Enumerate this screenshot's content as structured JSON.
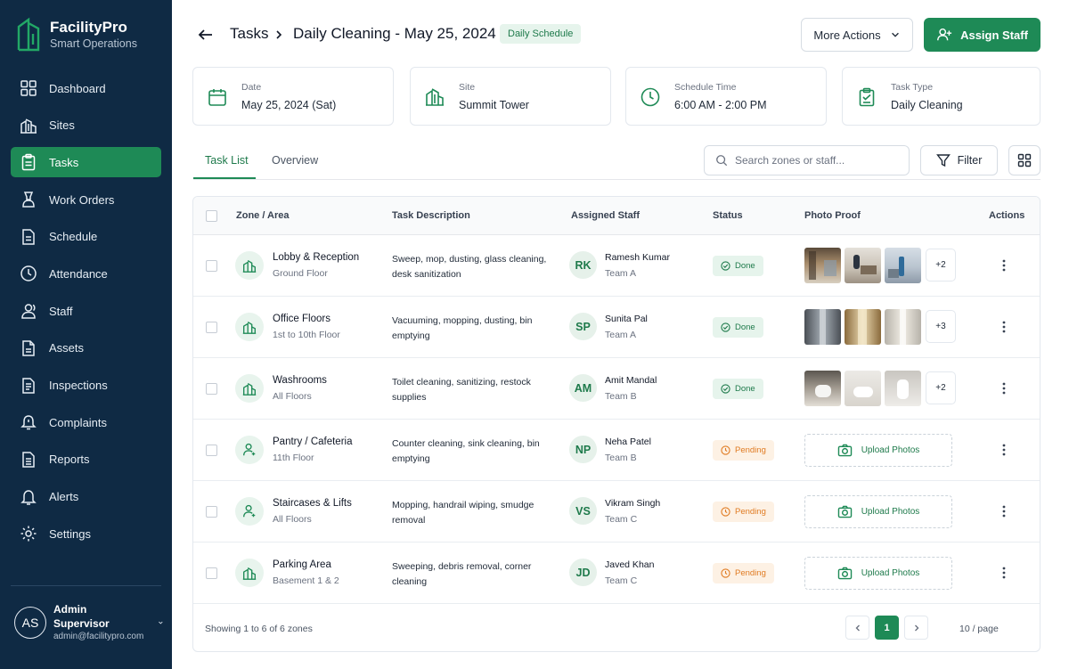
{
  "brand": {
    "name": "FacilityPro",
    "subtitle": "Smart Operations"
  },
  "sidebar": {
    "items": [
      {
        "label": "Dashboard",
        "icon": "dashboard-icon",
        "active": false
      },
      {
        "label": "Sites",
        "icon": "building-icon",
        "active": false
      },
      {
        "label": "Tasks",
        "icon": "clipboard-icon",
        "active": true
      },
      {
        "label": "Work Orders",
        "icon": "work-order-icon",
        "active": false
      },
      {
        "label": "Schedule",
        "icon": "document-icon",
        "active": false
      },
      {
        "label": "Attendance",
        "icon": "clock-icon",
        "active": false
      },
      {
        "label": "Staff",
        "icon": "users-icon",
        "active": false
      },
      {
        "label": "Assets",
        "icon": "file-icon",
        "active": false
      },
      {
        "label": "Inspections",
        "icon": "checklist-icon",
        "active": false
      },
      {
        "label": "Complaints",
        "icon": "alert-icon",
        "active": false
      },
      {
        "label": "Reports",
        "icon": "report-icon",
        "active": false
      },
      {
        "label": "Alerts",
        "icon": "bell-icon",
        "active": false
      },
      {
        "label": "Settings",
        "icon": "gear-icon",
        "active": false
      }
    ]
  },
  "user": {
    "initials": "AS",
    "name": "Admin Supervisor",
    "email": "admin@facilitypro.com"
  },
  "header": {
    "crumb_parent": "Tasks",
    "crumb_current": "Daily Cleaning - May 25, 2024",
    "badge": "Daily Schedule",
    "more_actions": "More Actions",
    "assign_staff": "Assign Staff"
  },
  "info_cards": [
    {
      "label": "Date",
      "value": "May 25, 2024 (Sat)",
      "icon": "calendar-icon"
    },
    {
      "label": "Site",
      "value": "Summit Tower",
      "icon": "building-icon"
    },
    {
      "label": "Schedule Time",
      "value": "6:00 AM - 2:00 PM",
      "icon": "clock-icon"
    },
    {
      "label": "Task Type",
      "value": "Daily Cleaning",
      "icon": "clipboard-icon"
    }
  ],
  "tabs": [
    {
      "label": "Task List",
      "active": true
    },
    {
      "label": "Overview",
      "active": false
    }
  ],
  "search": {
    "placeholder": "Search zones or staff..."
  },
  "filter_label": "Filter",
  "table": {
    "headers": [
      "Zone / Area",
      "Task Description",
      "Assigned Staff",
      "Status",
      "Photo Proof",
      "Actions"
    ],
    "rows": [
      {
        "zone": "Lobby & Reception",
        "floor": "Ground Floor",
        "desc": "Sweep, mop, dusting, glass cleaning, desk sanitization",
        "initials": "RK",
        "staff": "Ramesh Kumar",
        "team": "Team A",
        "status": "Done",
        "photos_more": "+2",
        "zone_icon": "building-icon",
        "status_color": "#1e7a4b"
      },
      {
        "zone": "Office Floors",
        "floor": "1st to 10th Floor",
        "desc": "Vacuuming, mopping, dusting, bin emptying",
        "initials": "SP",
        "staff": "Sunita Pal",
        "team": "Team A",
        "status": "Done",
        "photos_more": "+3",
        "zone_icon": "building-icon",
        "status_color": "#1e7a4b"
      },
      {
        "zone": "Washrooms",
        "floor": "All Floors",
        "desc": "Toilet cleaning, sanitizing, restock supplies",
        "initials": "AM",
        "staff": "Amit Mandal",
        "team": "Team B",
        "status": "Done",
        "photos_more": "+2",
        "zone_icon": "building-icon",
        "status_color": "#1e7a4b"
      },
      {
        "zone": "Pantry / Cafeteria",
        "floor": "11th Floor",
        "desc": "Counter cleaning, sink cleaning, bin emptying",
        "initials": "NP",
        "staff": "Neha Patel",
        "team": "Team B",
        "status": "Pending",
        "upload": "Upload Photos",
        "zone_icon": "user-pin-icon",
        "status_color": "#e07b22"
      },
      {
        "zone": "Staircases & Lifts",
        "floor": "All Floors",
        "desc": "Mopping, handrail wiping, smudge removal",
        "initials": "VS",
        "staff": "Vikram Singh",
        "team": "Team C",
        "status": "Pending",
        "upload": "Upload Photos",
        "zone_icon": "user-pin-icon",
        "status_color": "#e07b22"
      },
      {
        "zone": "Parking Area",
        "floor": "Basement 1 & 2",
        "desc": "Sweeping, debris removal, corner cleaning",
        "initials": "JD",
        "staff": "Javed Khan",
        "team": "Team C",
        "status": "Pending",
        "upload": "Upload Photos",
        "zone_icon": "building-icon",
        "status_color": "#e07b22"
      }
    ]
  },
  "footer": {
    "showing": "Showing 1 to 6 of 6 zones",
    "page": "1",
    "per_page": "10 / page"
  },
  "colors": {
    "brand_green": "#1e8a56",
    "sidebar_bg": "#0f2a44",
    "pending": "#e07b22"
  }
}
